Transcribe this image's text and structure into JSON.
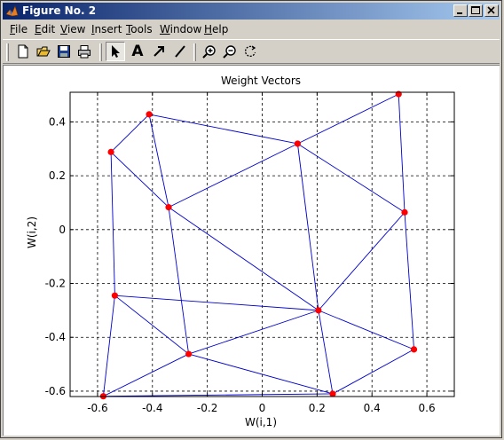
{
  "window": {
    "title": "Figure No. 2",
    "controls": [
      "minimize",
      "maximize",
      "close"
    ]
  },
  "menubar": {
    "items": [
      {
        "label": "File",
        "mnemonic": "F",
        "rest": "ile"
      },
      {
        "label": "Edit",
        "mnemonic": "E",
        "rest": "dit"
      },
      {
        "label": "View",
        "mnemonic": "V",
        "rest": "iew"
      },
      {
        "label": "Insert",
        "mnemonic": "I",
        "rest": "nsert"
      },
      {
        "label": "Tools",
        "mnemonic": "T",
        "rest": "ools"
      },
      {
        "label": "Window",
        "mnemonic": "W",
        "rest": "indow"
      },
      {
        "label": "Help",
        "mnemonic": "H",
        "rest": "elp"
      }
    ]
  },
  "toolbar": {
    "buttons": [
      {
        "name": "new-figure",
        "icon": "new-document-icon"
      },
      {
        "name": "open-file",
        "icon": "open-folder-icon"
      },
      {
        "name": "save",
        "icon": "save-disk-icon"
      },
      {
        "name": "print",
        "icon": "printer-icon"
      },
      {
        "name": "select",
        "icon": "arrow-pointer-icon",
        "active": true
      },
      {
        "name": "insert-text",
        "icon": "text-a-icon",
        "label": "A"
      },
      {
        "name": "insert-arrow",
        "icon": "arrow-icon"
      },
      {
        "name": "insert-line",
        "icon": "line-icon"
      },
      {
        "name": "zoom-in",
        "icon": "zoom-in-icon"
      },
      {
        "name": "zoom-out",
        "icon": "zoom-out-icon"
      },
      {
        "name": "rotate",
        "icon": "rotate-icon"
      }
    ]
  },
  "chart_data": {
    "type": "scatter",
    "title": "Weight Vectors",
    "xlabel": "W(i,1)",
    "ylabel": "W(i,2)",
    "xlim": [
      -0.7,
      0.7
    ],
    "ylim": [
      -0.62,
      0.51
    ],
    "xticks": [
      -0.6,
      -0.4,
      -0.2,
      0,
      0.2,
      0.4,
      0.6
    ],
    "xtick_labels": [
      "-0.6",
      "-0.4",
      "-0.2",
      "0",
      "0.2",
      "0.4",
      "0.6"
    ],
    "yticks": [
      -0.6,
      -0.4,
      -0.2,
      0,
      0.2,
      0.4
    ],
    "ytick_labels": [
      "-0.6",
      "-0.4",
      "-0.2",
      "0",
      "0.2",
      "0.4"
    ],
    "grid": true,
    "grid_style": "dashed",
    "marker_color": "#ff0000",
    "line_color": "#0000cc",
    "points": [
      {
        "x": -0.412,
        "y": 0.428
      },
      {
        "x": 0.129,
        "y": 0.319
      },
      {
        "x": 0.497,
        "y": 0.503
      },
      {
        "x": -0.551,
        "y": 0.288
      },
      {
        "x": -0.341,
        "y": 0.083
      },
      {
        "x": 0.519,
        "y": 0.064
      },
      {
        "x": -0.537,
        "y": -0.245
      },
      {
        "x": 0.205,
        "y": -0.3
      },
      {
        "x": -0.268,
        "y": -0.462
      },
      {
        "x": 0.553,
        "y": -0.445
      },
      {
        "x": -0.579,
        "y": -0.619
      },
      {
        "x": 0.257,
        "y": -0.61
      }
    ],
    "edges": [
      [
        0,
        1
      ],
      [
        1,
        2
      ],
      [
        2,
        5
      ],
      [
        5,
        9
      ],
      [
        9,
        11
      ],
      [
        11,
        10
      ],
      [
        10,
        6
      ],
      [
        6,
        3
      ],
      [
        3,
        0
      ],
      [
        0,
        4
      ],
      [
        3,
        4
      ],
      [
        4,
        1
      ],
      [
        4,
        8
      ],
      [
        4,
        7
      ],
      [
        1,
        5
      ],
      [
        1,
        7
      ],
      [
        7,
        5
      ],
      [
        7,
        6
      ],
      [
        7,
        8
      ],
      [
        7,
        9
      ],
      [
        7,
        11
      ],
      [
        8,
        6
      ],
      [
        8,
        10
      ],
      [
        8,
        11
      ]
    ]
  }
}
